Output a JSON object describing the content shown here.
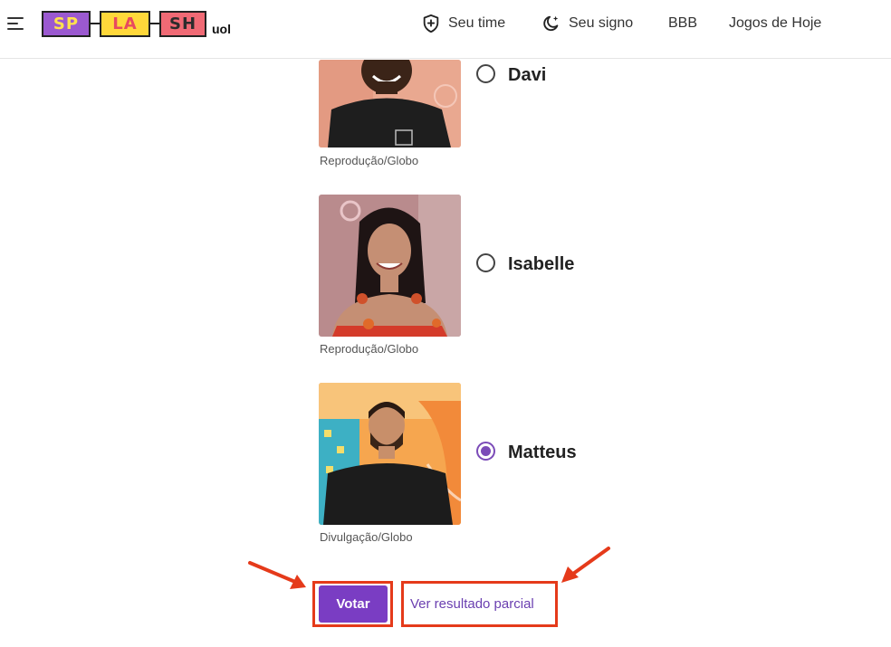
{
  "header": {
    "logo_tiles": [
      "SP",
      "LA",
      "SH"
    ],
    "logo_suffix": "uol",
    "nav": [
      {
        "label": "Seu time",
        "icon": "shield-plus-icon"
      },
      {
        "label": "Seu signo",
        "icon": "moon-star-icon"
      },
      {
        "label": "BBB"
      },
      {
        "label": "Jogos de Hoje"
      }
    ]
  },
  "poll": {
    "candidates": [
      {
        "name": "Davi",
        "credit": "Reprodução/Globo",
        "selected": false
      },
      {
        "name": "Isabelle",
        "credit": "Reprodução/Globo",
        "selected": false
      },
      {
        "name": "Matteus",
        "credit": "Divulgação/Globo",
        "selected": true
      }
    ],
    "vote_button": "Votar",
    "partial_result_link": "Ver resultado parcial"
  },
  "colors": {
    "accent_purple": "#7a3dc3",
    "highlight_red": "#e53a1a"
  }
}
